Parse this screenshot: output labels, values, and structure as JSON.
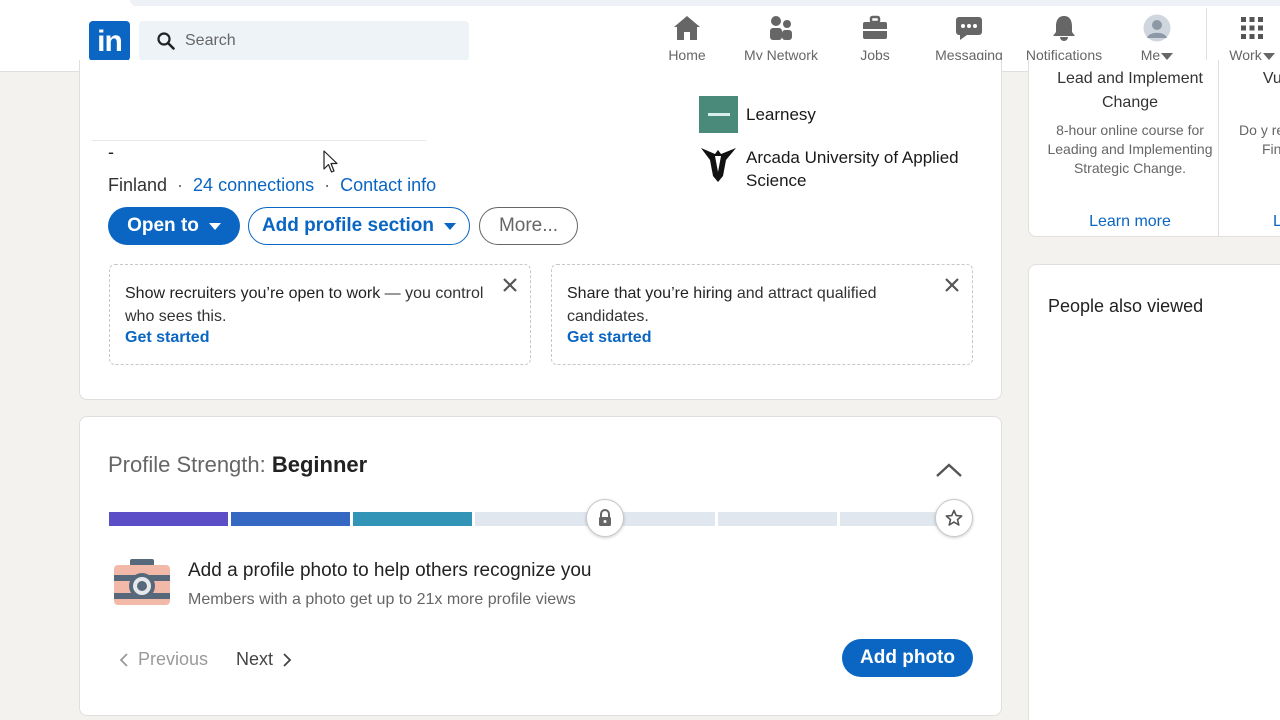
{
  "nav": {
    "logo_text": "in",
    "search_placeholder": "Search",
    "items": [
      {
        "label": "Home",
        "icon": "home-icon"
      },
      {
        "label": "My Network",
        "icon": "people-icon"
      },
      {
        "label": "Jobs",
        "icon": "briefcase-icon"
      },
      {
        "label": "Messaging",
        "icon": "chat-icon"
      },
      {
        "label": "Notifications",
        "icon": "bell-icon"
      },
      {
        "label": "Me",
        "icon": "avatar"
      },
      {
        "label": "Work",
        "icon": "grid-icon"
      }
    ]
  },
  "profile": {
    "headline_dash": "-",
    "location": "Finland",
    "connections": "24 connections",
    "contact_info": "Contact info",
    "separator": "·",
    "buttons": {
      "open_to": "Open to",
      "add_section": "Add profile section",
      "more": "More..."
    },
    "education": [
      {
        "name": "Learnesy"
      },
      {
        "name": "Arcada University of Applied Science"
      }
    ],
    "promos": [
      {
        "bold": "Show recruiters you’re open to work",
        "rest": " — you control who sees this.",
        "link": "Get started"
      },
      {
        "bold": "Share that you’re hiring",
        "rest": " and attract qualified candidates.",
        "link": "Get started"
      }
    ]
  },
  "strength": {
    "label": "Profile Strength:",
    "level": "Beginner",
    "segments_filled": 3,
    "segments_total": 7,
    "colors": [
      "#5c4ec6",
      "#3568c2",
      "#3295b8"
    ],
    "tip_title": "Add a profile photo to help others recognize you",
    "tip_sub": "Members with a photo get up to 21x more profile views",
    "previous": "Previous",
    "next": "Next",
    "add_photo": "Add photo"
  },
  "ad": {
    "col1": {
      "title": "Lead and Implement Change",
      "desc": "8-hour online course for Leading and Implementing Strategic Change.",
      "link": "Learn more"
    },
    "col2": {
      "title": "Vulne",
      "desc": "Do y requirem Find O",
      "link": "Le"
    }
  },
  "people": {
    "title": "People also viewed"
  },
  "colors": {
    "brand": "#0a66c2",
    "background": "#f3f2ef"
  }
}
